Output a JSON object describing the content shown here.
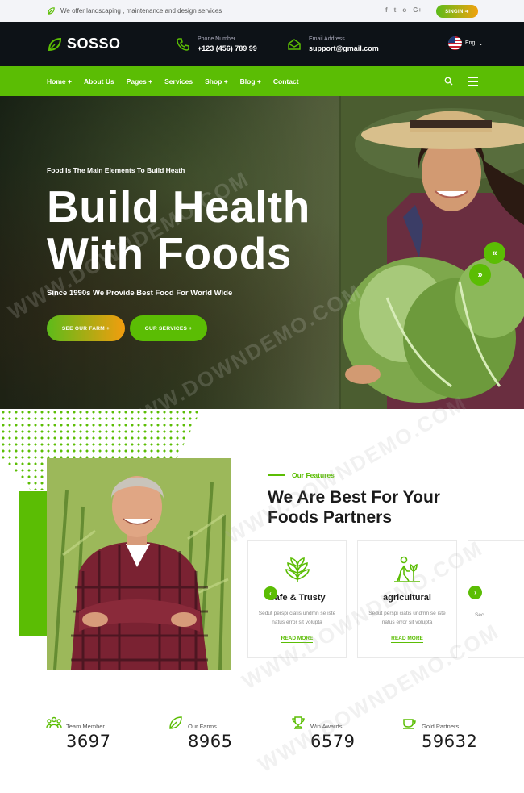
{
  "topbar": {
    "tagline": "We offer landscaping , maintenance and design services",
    "socials": [
      "f",
      "t",
      "o",
      "G+"
    ],
    "signin_label": "SINGIN ➜"
  },
  "header": {
    "logo_text": "SOSSO",
    "phone_label": "Phone Number",
    "phone_value": "+123 (456) 789 99",
    "email_label": "Email Address",
    "email_value": "support@gmail.com",
    "language": "Eng"
  },
  "nav": {
    "items": [
      {
        "label": "Home +"
      },
      {
        "label": "About Us"
      },
      {
        "label": "Pages +"
      },
      {
        "label": "Services"
      },
      {
        "label": "Shop +"
      },
      {
        "label": "Blog +"
      },
      {
        "label": "Contact"
      }
    ]
  },
  "hero": {
    "eyebrow": "Food Is The Main Elements To Build Heath",
    "title_line1": "Build Health",
    "title_line2": "With Foods",
    "subtitle": "Since 1990s We Provide Best Food For World Wide",
    "btn_farm": "SEE OUR FARM +",
    "btn_services": "OUR SERVICES +",
    "arrow_prev": "«",
    "arrow_next": "»"
  },
  "features": {
    "eyebrow": "Our Features",
    "title_line1": "We Are Best For Your",
    "title_line2": "Foods Partners",
    "cards": [
      {
        "title": "Safe & Trusty",
        "desc_line1": "Sedut perspi ciatis undmn se iste",
        "desc_line2": "natus error sit volupta",
        "link": "READ MORE"
      },
      {
        "title": "agricultural",
        "desc_line1": "Sedut perspi ciatis undmn se iste",
        "desc_line2": "natus error sit volupta",
        "link": "READ MORE"
      },
      {
        "title": "",
        "desc_line1": "Sec",
        "desc_line2": "",
        "link": ""
      }
    ],
    "arrow_prev": "‹",
    "arrow_next": "›"
  },
  "stats": [
    {
      "label": "Team Member",
      "value": "3697"
    },
    {
      "label": "Our Farms",
      "value": "8965"
    },
    {
      "label": "Win Awards",
      "value": "6579"
    },
    {
      "label": "Gold Partners",
      "value": "59632"
    }
  ],
  "watermark": "WWW.DOWNDEMO.COM",
  "colors": {
    "accent": "#5bbd04",
    "dark": "#0d1217",
    "orange": "#f29d0e"
  }
}
